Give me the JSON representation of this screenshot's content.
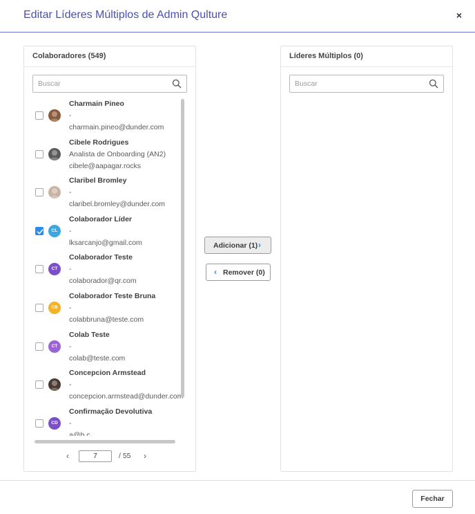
{
  "modal": {
    "title": "Editar Líderes Múltiplos de Admin Qulture",
    "close_label": "×"
  },
  "left_panel": {
    "title": "Colaboradores (549)",
    "search_placeholder": "Buscar",
    "items": [
      {
        "name": "Charmain Pineo",
        "role": "-",
        "email": "charmain.pineo@dunder.com",
        "checked": false,
        "avatar_type": "photo",
        "avatar_color": "#8a5a3a"
      },
      {
        "name": "Cibele Rodrigues",
        "role": "Analista de Onboarding (AN2)",
        "email": "cibele@aapagar.rocks",
        "checked": false,
        "avatar_type": "photo",
        "avatar_color": "#5a5a5a"
      },
      {
        "name": "Claribel Bromley",
        "role": "-",
        "email": "claribel.bromley@dunder.com",
        "checked": false,
        "avatar_type": "photo",
        "avatar_color": "#c9b4a4"
      },
      {
        "name": "Colaborador Líder",
        "role": "-",
        "email": "lksarcanjo@gmail.com",
        "checked": true,
        "avatar_type": "initials",
        "initials": "CL",
        "avatar_color": "#3fa6e4"
      },
      {
        "name": "Colaborador Teste",
        "role": "-",
        "email": "colaborador@qr.com",
        "checked": false,
        "avatar_type": "initials",
        "initials": "CT",
        "avatar_color": "#7b4fc9"
      },
      {
        "name": "Colaborador Teste Bruna",
        "role": "-",
        "email": "colabbruna@teste.com",
        "checked": false,
        "avatar_type": "initials",
        "initials": "CB",
        "avatar_color": "#f2b32a"
      },
      {
        "name": "Colab Teste",
        "role": "-",
        "email": "colab@teste.com",
        "checked": false,
        "avatar_type": "initials",
        "initials": "CT",
        "avatar_color": "#9a63d6"
      },
      {
        "name": "Concepcion Armstead",
        "role": "-",
        "email": "concepcion.armstead@dunder.com",
        "checked": false,
        "avatar_type": "photo",
        "avatar_color": "#4a3a32"
      },
      {
        "name": "Confirmação Devolutiva",
        "role": "-",
        "email": "a@b.c",
        "checked": false,
        "avatar_type": "initials",
        "initials": "CD",
        "avatar_color": "#7b4fc9"
      }
    ],
    "pagination": {
      "current_page": "7",
      "total_label": "/  55",
      "prev_icon": "chevron-left",
      "next_icon": "chevron-right"
    }
  },
  "right_panel": {
    "title": "Líderes Múltiplos (0)",
    "search_placeholder": "Buscar"
  },
  "actions": {
    "add_label": "Adicionar (1)",
    "remove_label": "Remover (0)"
  },
  "footer": {
    "close_button_label": "Fechar"
  },
  "colors": {
    "accent": "#4a4fb5",
    "primary_blue": "#2b8ce6"
  }
}
